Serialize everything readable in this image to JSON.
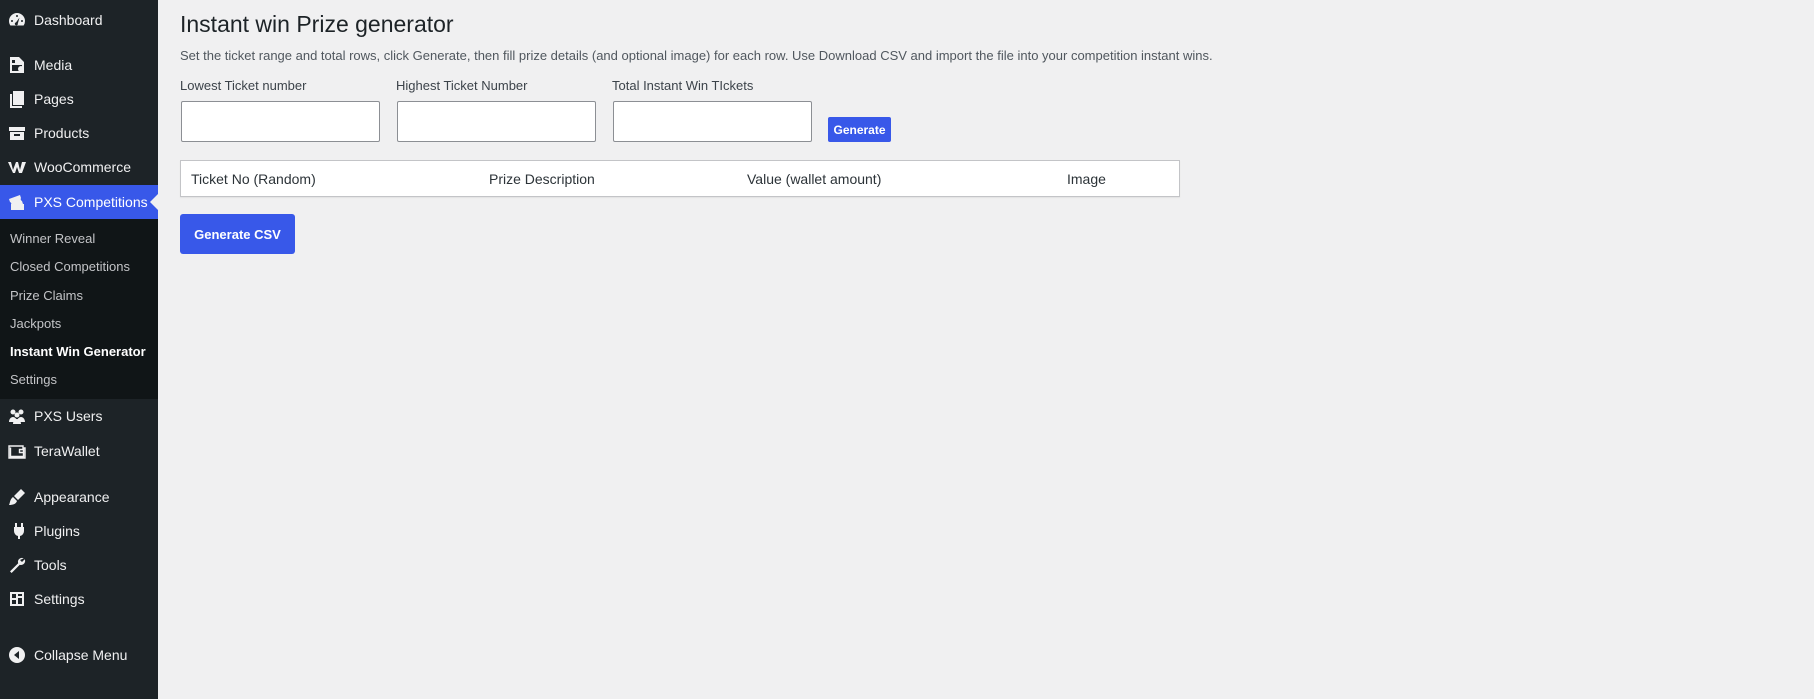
{
  "sidebar": {
    "items": [
      {
        "label": "Dashboard",
        "icon": "dashboard-icon"
      },
      {
        "label": "Media",
        "icon": "media-icon"
      },
      {
        "label": "Pages",
        "icon": "pages-icon"
      },
      {
        "label": "Products",
        "icon": "products-icon"
      },
      {
        "label": "WooCommerce",
        "icon": "woocommerce-icon"
      },
      {
        "label": "PXS Competitions",
        "icon": "tickets-icon"
      },
      {
        "label": "PXS Users",
        "icon": "users-icon"
      },
      {
        "label": "TeraWallet",
        "icon": "wallet-icon"
      },
      {
        "label": "Appearance",
        "icon": "brush-icon"
      },
      {
        "label": "Plugins",
        "icon": "plugin-icon"
      },
      {
        "label": "Tools",
        "icon": "wrench-icon"
      },
      {
        "label": "Settings",
        "icon": "settings-icon"
      },
      {
        "label": "Collapse Menu",
        "icon": "collapse-icon"
      }
    ],
    "submenu": [
      "Winner Reveal",
      "Closed Competitions",
      "Prize Claims",
      "Jackpots",
      "Instant Win Generator",
      "Settings"
    ]
  },
  "main": {
    "title": "Instant win Prize generator",
    "description": "Set the ticket range and total rows, click Generate, then fill prize details (and optional image) for each row. Use Download CSV and import the file into your competition instant wins.",
    "fields": [
      {
        "label": "Lowest Ticket number",
        "value": ""
      },
      {
        "label": "Highest Ticket Number",
        "value": ""
      },
      {
        "label": "Total Instant Win TIckets",
        "value": ""
      }
    ],
    "generate_label": "Generate",
    "table_headers": [
      "Ticket No (Random)",
      "Prize Description",
      "Value (wallet amount)",
      "Image"
    ],
    "csv_label": "Generate CSV"
  },
  "colors": {
    "accent": "#3858e9",
    "sidebar": "#1d2327",
    "submenu": "#101517",
    "background": "#f0f0f1"
  }
}
